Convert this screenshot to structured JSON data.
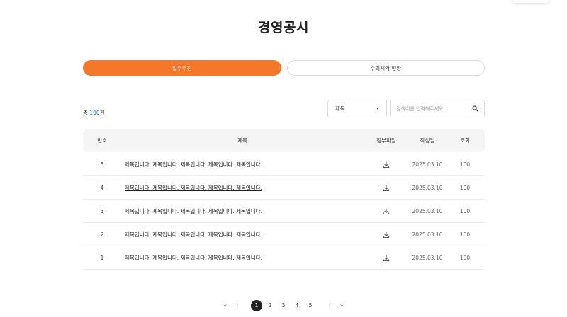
{
  "page": {
    "title": "경영공시"
  },
  "tabs": [
    {
      "label": "업무추진",
      "active": true
    },
    {
      "label": "수의계약 현황",
      "active": false
    }
  ],
  "summary": {
    "prefix": "총 ",
    "count": "100",
    "suffix": "건"
  },
  "filter": {
    "selected": "제목"
  },
  "search": {
    "placeholder": "검색어를 입력해주세요."
  },
  "table": {
    "headers": {
      "no": "번호",
      "title": "제목",
      "file": "첨부파일",
      "date": "작성일",
      "views": "조회"
    },
    "rows": [
      {
        "no": "5",
        "title": "제목입니다. 제목입니다. 제목입니다. 제목입니다. 제목입니다.",
        "date": "2025.03.10",
        "views": "100"
      },
      {
        "no": "4",
        "title": "제목입니다. 제목입니다. 제목입니다. 제목입니다. 제목입니다.",
        "date": "2025.03.10",
        "views": "100"
      },
      {
        "no": "3",
        "title": "제목입니다. 제목입니다. 제목입니다. 제목입니다. 제목입니다.",
        "date": "2025.03.10",
        "views": "100"
      },
      {
        "no": "2",
        "title": "제목입니다. 제목입니다. 제목입니다. 제목입니다. 제목입니다.",
        "date": "2025.03.10",
        "views": "100"
      },
      {
        "no": "1",
        "title": "제목입니다. 제목입니다. 제목입니다. 제목입니다. 제목입니다.",
        "date": "2025.03.10",
        "views": "100"
      }
    ]
  },
  "pagination": {
    "first": "«",
    "prev": "‹",
    "pages": [
      "1",
      "2",
      "3",
      "4",
      "5"
    ],
    "current": "1",
    "next": "›",
    "last": "»"
  },
  "colors": {
    "accent": "#f5772a",
    "count": "#1f5fbf"
  },
  "icons": {
    "search": "search-icon",
    "download": "download-icon",
    "caret": "caret-down-icon"
  }
}
